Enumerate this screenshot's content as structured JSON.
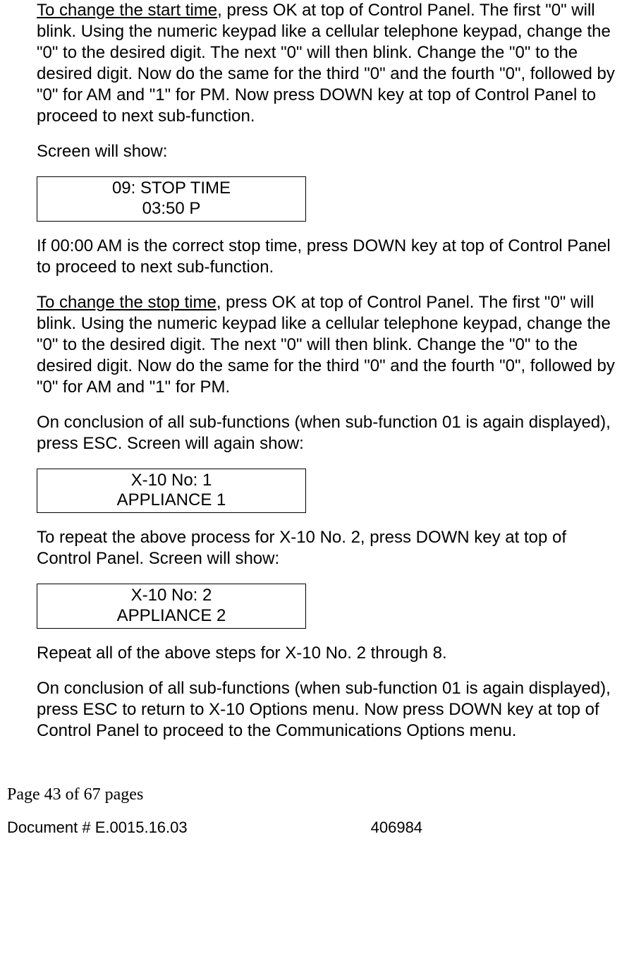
{
  "para1_underline": "To change the start time",
  "para1_rest": ", press OK at top of Control Panel. The first \"0\" will blink. Using the numeric keypad like a cellular telephone keypad, change the \"0\" to the desired digit. The next \"0\" will then blink. Change the \"0\" to the desired digit. Now do the same for the third \"0\" and the fourth \"0\", followed by \"0\" for AM and \"1\" for PM. Now press DOWN key at top of Control Panel to proceed to next sub-function.",
  "para2": "Screen will show:",
  "screen1_line1": "09: STOP TIME",
  "screen1_line2": "03:50 P",
  "para3": "If 00:00 AM is the correct stop time, press DOWN key at top of Control Panel to proceed to next sub-function.",
  "para4_underline": "To change the stop time",
  "para4_rest": ", press OK at top of Control Panel. The first \"0\" will blink. Using the numeric keypad like a cellular telephone keypad, change the \"0\" to the desired digit. The next \"0\" will then blink. Change the \"0\" to the desired digit. Now do the same for the third \"0\" and the fourth \"0\", followed by \"0\" for AM and \"1\" for PM.",
  "para5": "On conclusion of all sub-functions (when sub-function 01 is again displayed), press ESC. Screen will again show:",
  "screen2_line1": "X-10 No: 1",
  "screen2_line2": "APPLIANCE 1",
  "para6": "To repeat the above process for X-10 No. 2, press DOWN key at top of Control Panel. Screen will show:",
  "screen3_line1": "X-10 No: 2",
  "screen3_line2": "APPLIANCE 2",
  "para7": "Repeat all of the above steps for X-10 No. 2 through 8.",
  "para8": "On conclusion of all sub-functions (when sub-function 01 is again displayed), press ESC to return to X-10 Options menu. Now press DOWN key at top of Control Panel to proceed to the Communications Options menu.",
  "page_info": "Page 43 of  67 pages",
  "doc_number": "Document # E.0015.16.03",
  "doc_right": "406984"
}
